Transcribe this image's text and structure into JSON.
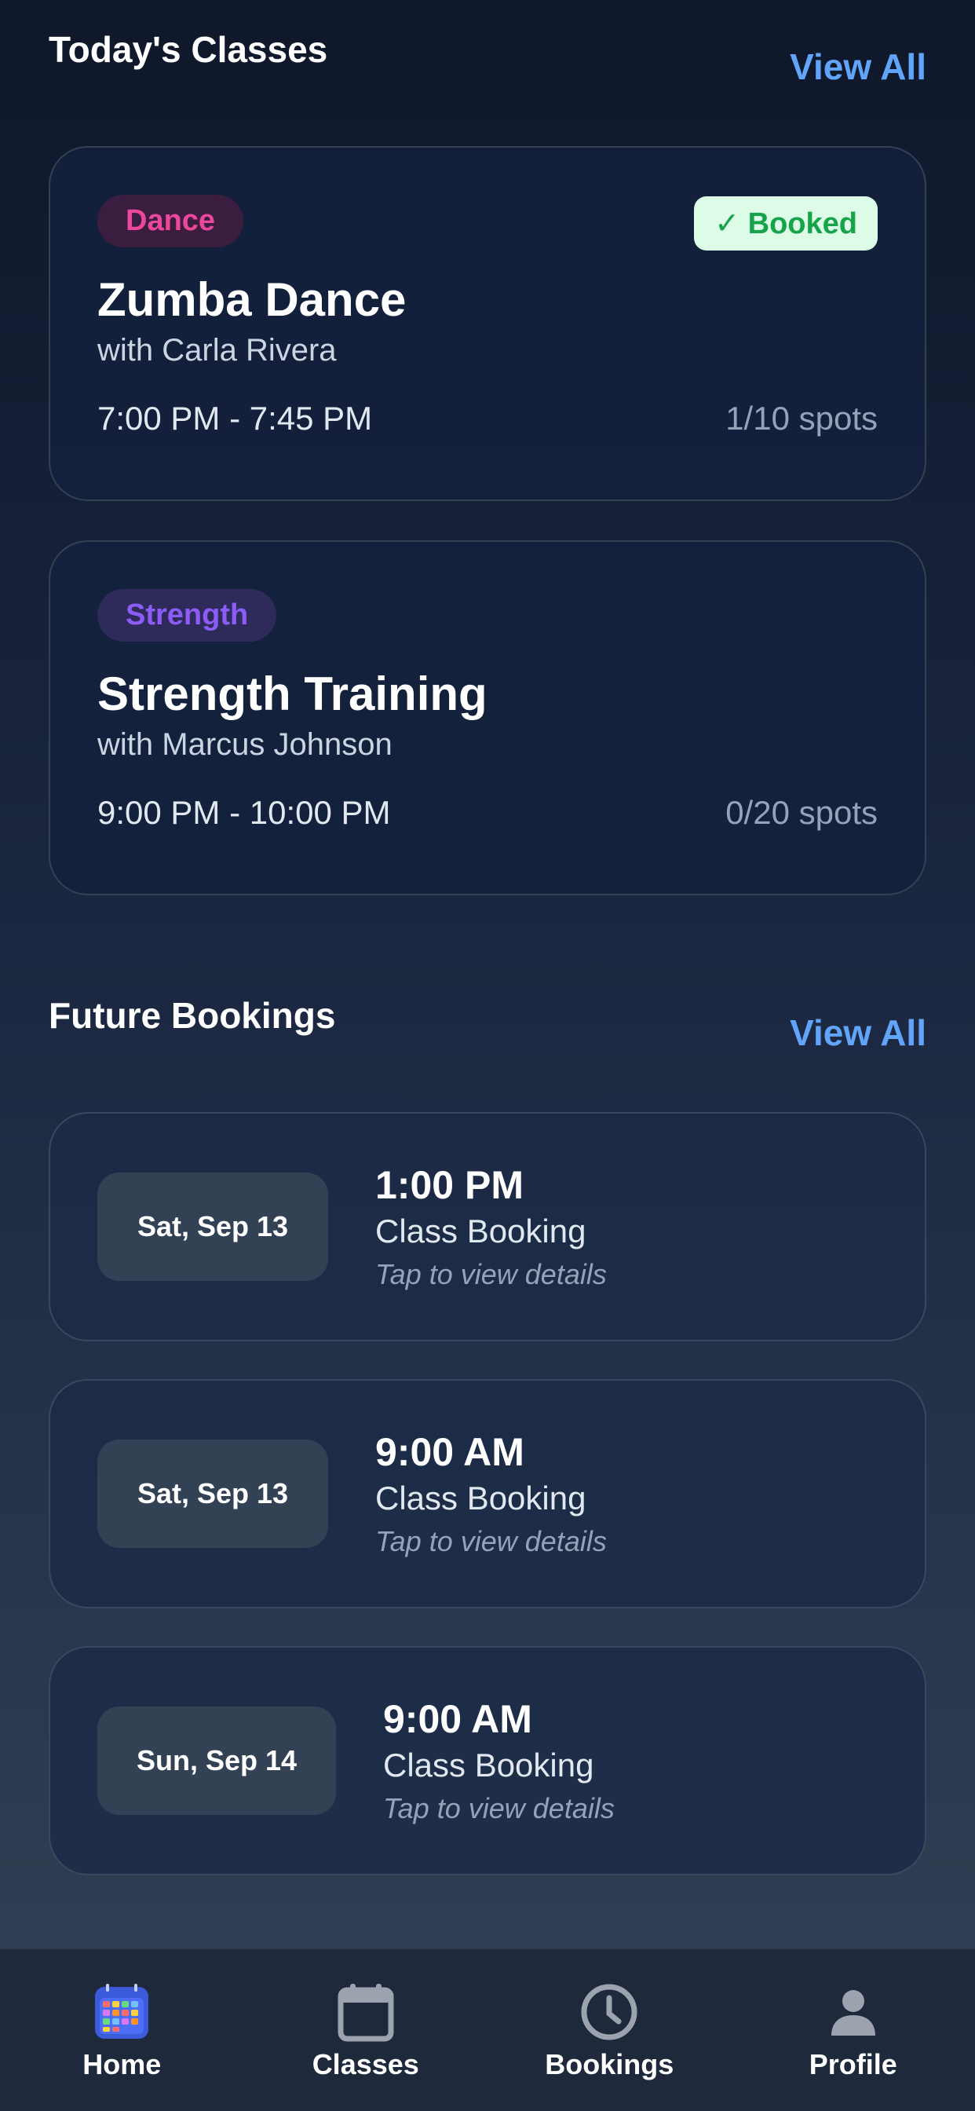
{
  "today": {
    "title": "Today's Classes",
    "view_all": "View All",
    "classes": [
      {
        "category": "Dance",
        "booked_label": "✓ Booked",
        "name": "Zumba Dance",
        "instructor": "with Carla Rivera",
        "time": "7:00 PM - 7:45 PM",
        "spots": "1/10 spots"
      },
      {
        "category": "Strength",
        "name": "Strength Training",
        "instructor": "with Marcus Johnson",
        "time": "9:00 PM - 10:00 PM",
        "spots": "0/20 spots"
      }
    ]
  },
  "future": {
    "title": "Future Bookings",
    "view_all": "View All",
    "bookings": [
      {
        "date": "Sat, Sep 13",
        "time": "1:00 PM",
        "label": "Class Booking",
        "hint": "Tap to view details"
      },
      {
        "date": "Sat, Sep 13",
        "time": "9:00 AM",
        "label": "Class Booking",
        "hint": "Tap to view details"
      },
      {
        "date": "Sun, Sep 14",
        "time": "9:00 AM",
        "label": "Class Booking",
        "hint": "Tap to view details"
      }
    ]
  },
  "tabs": [
    {
      "label": "Home",
      "icon": "calendar-grid-icon",
      "active": true
    },
    {
      "label": "Classes",
      "icon": "calendar-icon"
    },
    {
      "label": "Bookings",
      "icon": "clock-icon"
    },
    {
      "label": "Profile",
      "icon": "person-icon"
    }
  ],
  "colors": {
    "accent": "#60a5fa",
    "dance": "#ec4899",
    "strength": "#8b5cf6",
    "booked": "#16a34a"
  }
}
